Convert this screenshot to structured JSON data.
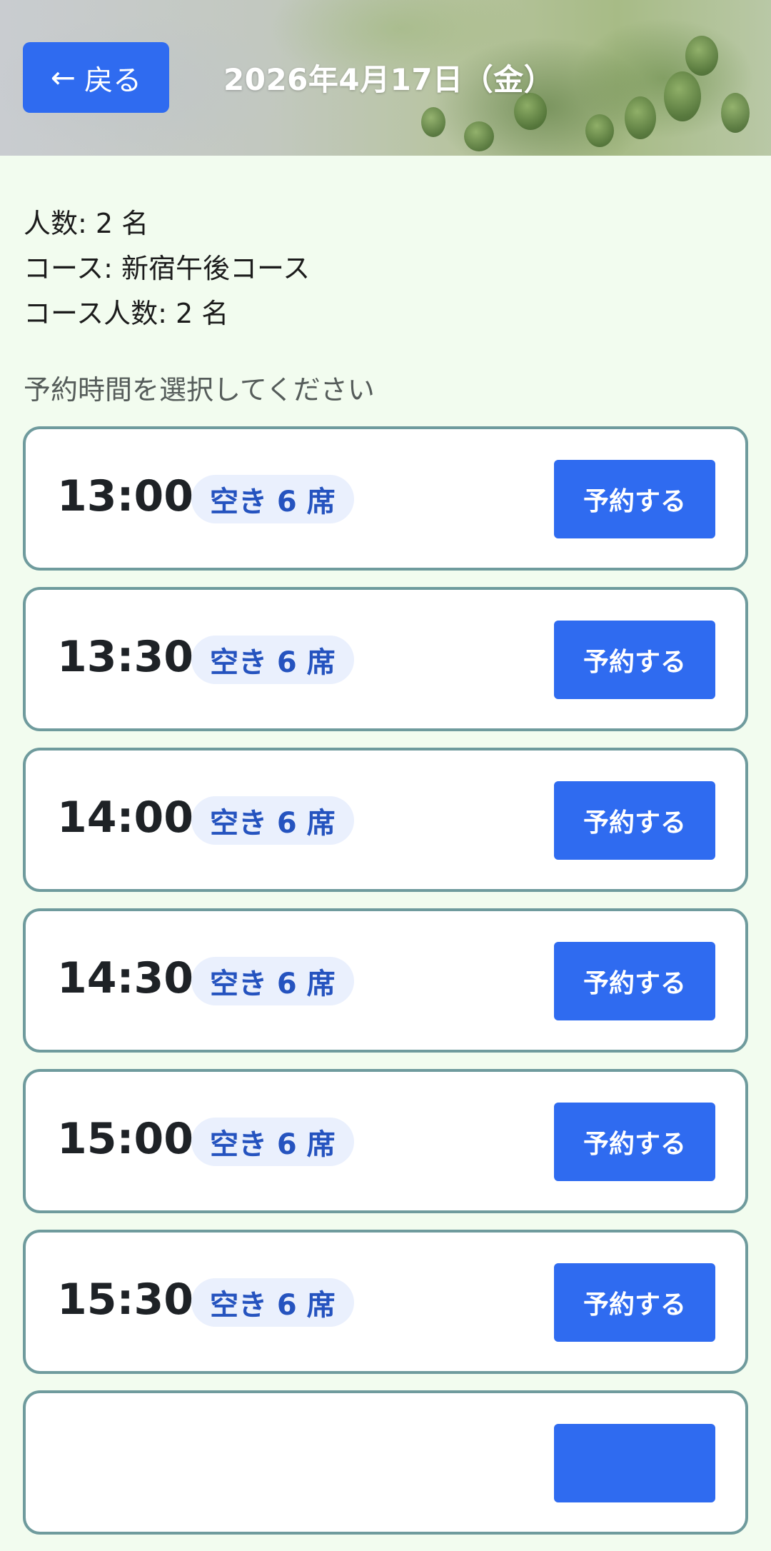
{
  "header": {
    "back_label": "戻る",
    "title": "2026年4月17日（金）"
  },
  "info": {
    "people": "人数: 2 名",
    "course": "コース: 新宿午後コース",
    "course_people": "コース人数: 2 名"
  },
  "prompt": "予約時間を選択してください",
  "slots": [
    {
      "time": "13:00",
      "seats": "空き 6 席",
      "button": "予約する"
    },
    {
      "time": "13:30",
      "seats": "空き 6 席",
      "button": "予約する"
    },
    {
      "time": "14:00",
      "seats": "空き 6 席",
      "button": "予約する"
    },
    {
      "time": "14:30",
      "seats": "空き 6 席",
      "button": "予約する"
    },
    {
      "time": "15:00",
      "seats": "空き 6 席",
      "button": "予約する"
    },
    {
      "time": "15:30",
      "seats": "空き 6 席",
      "button": "予約する"
    },
    {
      "time": "",
      "seats": "",
      "button": ""
    }
  ],
  "colors": {
    "accent": "#2f6bf0",
    "background": "#f2fcef",
    "slot_border": "#6f9b9d",
    "badge_bg": "#eaf0fd",
    "badge_text": "#2553bf"
  },
  "icons": {
    "back": "left-arrow-icon"
  }
}
